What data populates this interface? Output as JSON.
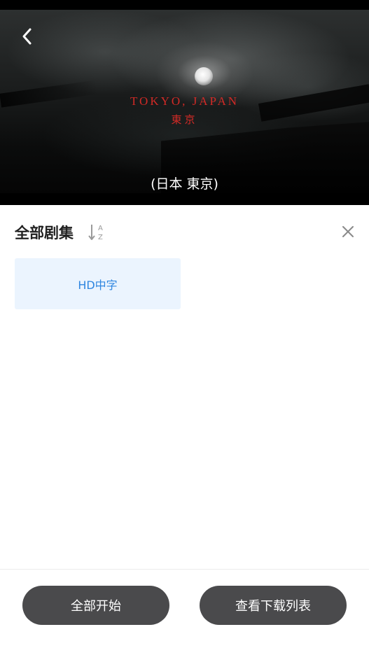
{
  "player": {
    "title_en": "TOKYO, JAPAN",
    "title_cjk": "東京",
    "subtitle": "(日本 東京)",
    "back_icon": "chevron-left-icon"
  },
  "episodes": {
    "title": "全部剧集",
    "sort_icon": "sort-alphabetical-icon",
    "close_icon": "close-icon",
    "items": [
      {
        "label": "HD中字"
      }
    ],
    "accent_color": "#2f86e0",
    "chip_bg": "#ebf4fe"
  },
  "actions": {
    "start_all": "全部开始",
    "view_downloads": "查看下载列表"
  }
}
